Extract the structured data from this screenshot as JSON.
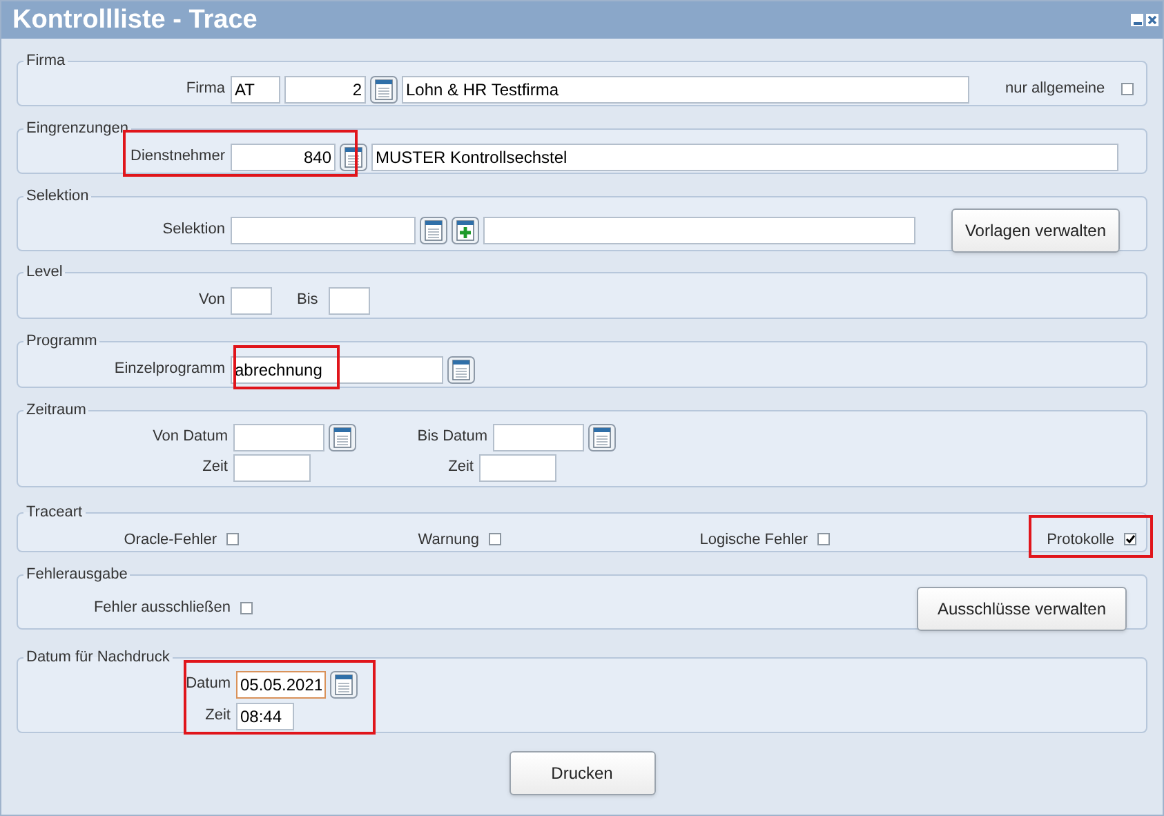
{
  "window": {
    "title": "Kontrollliste - Trace"
  },
  "firma": {
    "legend": "Firma",
    "label": "Firma",
    "country": "AT",
    "number": "2",
    "name": "Lohn & HR Testfirma",
    "general_label": "nur allgemeine",
    "general_checked": false
  },
  "eingrenzungen": {
    "legend": "Eingrenzungen",
    "label": "Dienstnehmer",
    "value": "840",
    "name": "MUSTER Kontrollsechstel",
    "highlighted": true
  },
  "selektion": {
    "legend": "Selektion",
    "label": "Selektion",
    "button": "Vorlagen verwalten"
  },
  "level": {
    "legend": "Level",
    "from_label": "Von",
    "to_label": "Bis"
  },
  "programm": {
    "legend": "Programm",
    "label": "Einzelprogramm",
    "value": "abrechnung",
    "highlighted": true
  },
  "zeitraum": {
    "legend": "Zeitraum",
    "from_date_label": "Von Datum",
    "from_time_label": "Zeit",
    "to_date_label": "Bis Datum",
    "to_time_label": "Zeit"
  },
  "traceart": {
    "legend": "Traceart",
    "options": [
      {
        "label": "Oracle-Fehler",
        "checked": false,
        "highlighted": false
      },
      {
        "label": "Warnung",
        "checked": false,
        "highlighted": false
      },
      {
        "label": "Logische Fehler",
        "checked": false,
        "highlighted": false
      },
      {
        "label": "Protokolle",
        "checked": true,
        "highlighted": true
      }
    ]
  },
  "fehlerausgabe": {
    "legend": "Fehlerausgabe",
    "exclude_label": "Fehler ausschließen",
    "exclude_checked": false,
    "button": "Ausschlüsse verwalten"
  },
  "nachdruck": {
    "legend": "Datum für Nachdruck",
    "date_label": "Datum",
    "date": "05.05.2021",
    "time_label": "Zeit",
    "time": "08:44",
    "highlighted": true
  },
  "print_button": "Drucken"
}
